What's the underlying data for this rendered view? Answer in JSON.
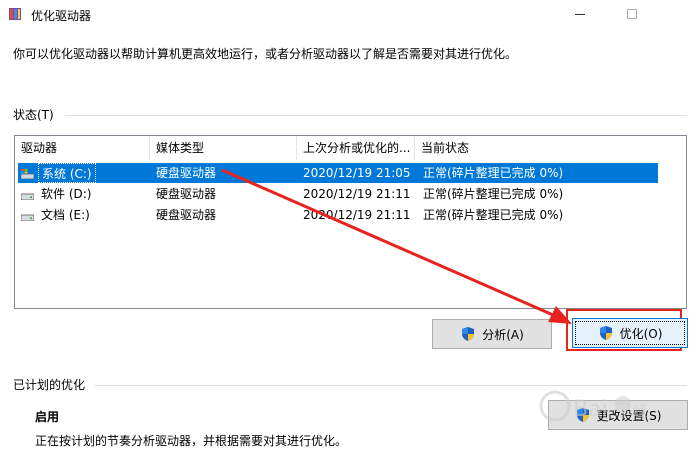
{
  "window": {
    "title": "优化驱动器"
  },
  "intro_text": "你可以优化驱动器以帮助计算机更高效地运行，或者分析驱动器以了解是否需要对其进行优化。",
  "status_section": {
    "label": "状态(T)"
  },
  "table": {
    "columns": [
      "驱动器",
      "媒体类型",
      "上次分析或优化的...",
      "当前状态"
    ],
    "rows": [
      {
        "drive": "系统 (C:)",
        "media": "硬盘驱动器",
        "last": "2020/12/19 21:05",
        "status": "正常(碎片整理已完成 0%)"
      },
      {
        "drive": "软件 (D:)",
        "media": "硬盘驱动器",
        "last": "2020/12/19 21:11",
        "status": "正常(碎片整理已完成 0%)"
      },
      {
        "drive": "文档 (E:)",
        "media": "硬盘驱动器",
        "last": "2020/12/19 21:11",
        "status": "正常(碎片整理已完成 0%)"
      }
    ]
  },
  "buttons": {
    "analyze": "分析(A)",
    "optimize": "优化(O)",
    "change_settings": "更改设置(S)"
  },
  "scheduled_section": {
    "label": "已计划的优化",
    "state": "启用",
    "description": "正在按计划的节奏分析驱动器，并根据需要对其进行优化。"
  },
  "icons": {
    "app": "defrag-app-icon",
    "drive": "hard-drive-icon",
    "shield": "uac-shield-icon"
  },
  "colors": {
    "selection": "#0078d7",
    "annotation": "#e8231f"
  }
}
